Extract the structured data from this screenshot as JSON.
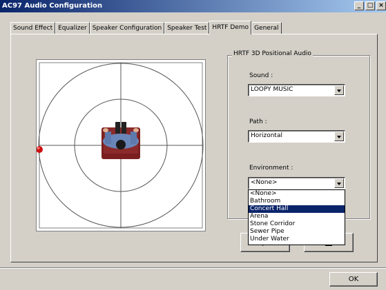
{
  "window": {
    "title": "AC97 Audio Configuration",
    "controls": [
      "_",
      "□",
      "×"
    ]
  },
  "tabs": [
    {
      "label": "Sound Effect"
    },
    {
      "label": "Equalizer"
    },
    {
      "label": "Speaker Configuration"
    },
    {
      "label": "Speaker Test"
    },
    {
      "label": "HRTF Demo",
      "active": true
    },
    {
      "label": "General"
    }
  ],
  "hrtf": {
    "group_title": "HRTF 3D Positional Audio",
    "sound": {
      "label": "Sound :",
      "value": "LOOPY MUSIC"
    },
    "path": {
      "label": "Path :",
      "value": "Horizontal"
    },
    "environment": {
      "label": "Environment :",
      "value": "<None>",
      "options": [
        "<None>",
        "Bathroom",
        "Concert Hall",
        "Arena",
        "Stone Corridor",
        "Sewer Pipe",
        "Under Water"
      ],
      "highlighted": "Concert Hall"
    }
  },
  "graph": {
    "icons": [
      "listener-icon",
      "sound-source-icon"
    ],
    "source_color": "#cc1010"
  },
  "footer": {
    "ok_label": "OK"
  }
}
